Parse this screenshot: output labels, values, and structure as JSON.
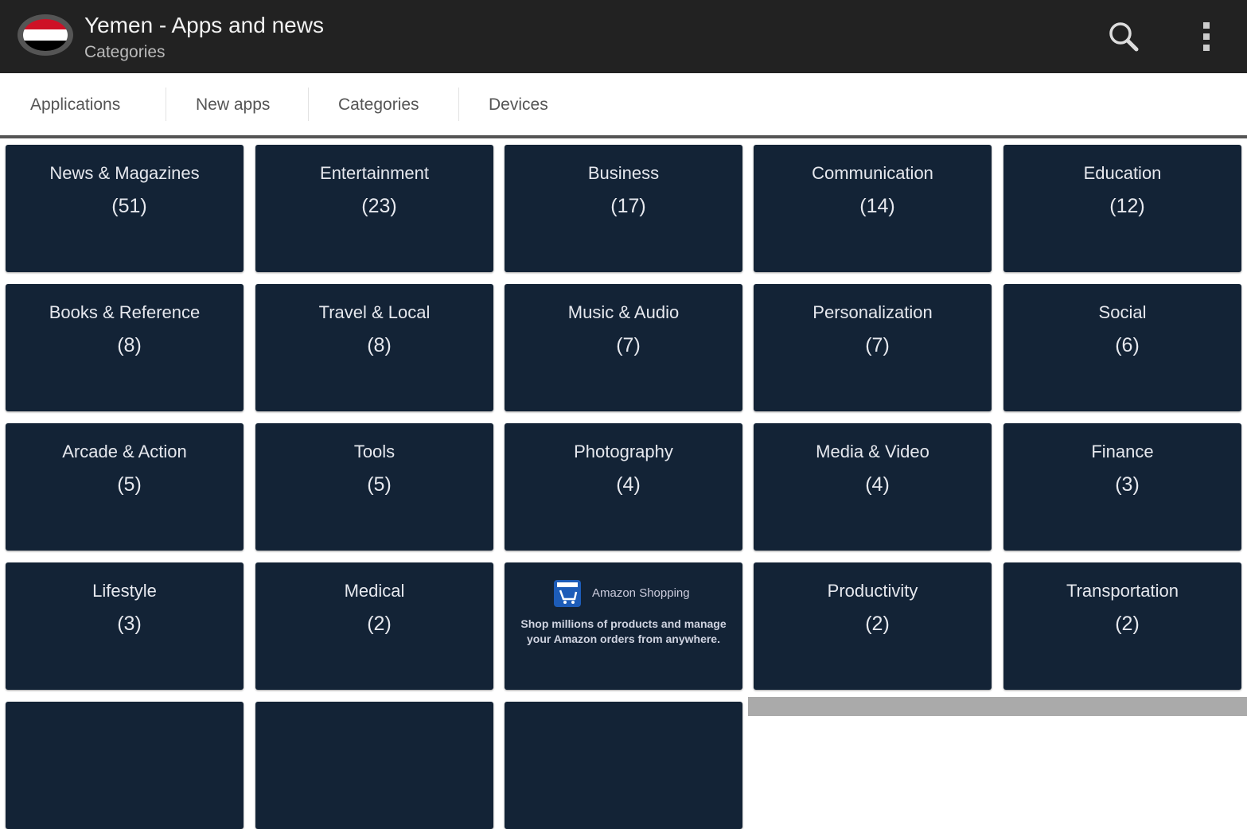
{
  "header": {
    "title": "Yemen - Apps and news",
    "subtitle": "Categories",
    "flag_colors": [
      "#ce1126",
      "#ffffff",
      "#000000"
    ]
  },
  "tabs": [
    {
      "label": "Applications"
    },
    {
      "label": "New apps"
    },
    {
      "label": "Categories"
    },
    {
      "label": "Devices"
    }
  ],
  "categories": [
    {
      "name": "News & Magazines",
      "count": "(51)"
    },
    {
      "name": "Entertainment",
      "count": "(23)"
    },
    {
      "name": "Business",
      "count": "(17)"
    },
    {
      "name": "Communication",
      "count": "(14)"
    },
    {
      "name": "Education",
      "count": "(12)"
    },
    {
      "name": "Books & Reference",
      "count": "(8)"
    },
    {
      "name": "Travel & Local",
      "count": "(8)"
    },
    {
      "name": "Music & Audio",
      "count": "(7)"
    },
    {
      "name": "Personalization",
      "count": "(7)"
    },
    {
      "name": "Social",
      "count": "(6)"
    },
    {
      "name": "Arcade & Action",
      "count": "(5)"
    },
    {
      "name": "Tools",
      "count": "(5)"
    },
    {
      "name": "Photography",
      "count": "(4)"
    },
    {
      "name": "Media & Video",
      "count": "(4)"
    },
    {
      "name": "Finance",
      "count": "(3)"
    },
    {
      "name": "Lifestyle",
      "count": "(3)"
    },
    {
      "name": "Medical",
      "count": "(2)"
    },
    {
      "ad": true
    },
    {
      "name": "Productivity",
      "count": "(2)"
    },
    {
      "name": "Transportation",
      "count": "(2)"
    },
    {
      "name": "",
      "count": ""
    },
    {
      "name": "",
      "count": ""
    },
    {
      "name": "",
      "count": ""
    }
  ],
  "ad": {
    "title": "Amazon Shopping",
    "text": "Shop millions of products and manage your Amazon orders from anywhere."
  }
}
